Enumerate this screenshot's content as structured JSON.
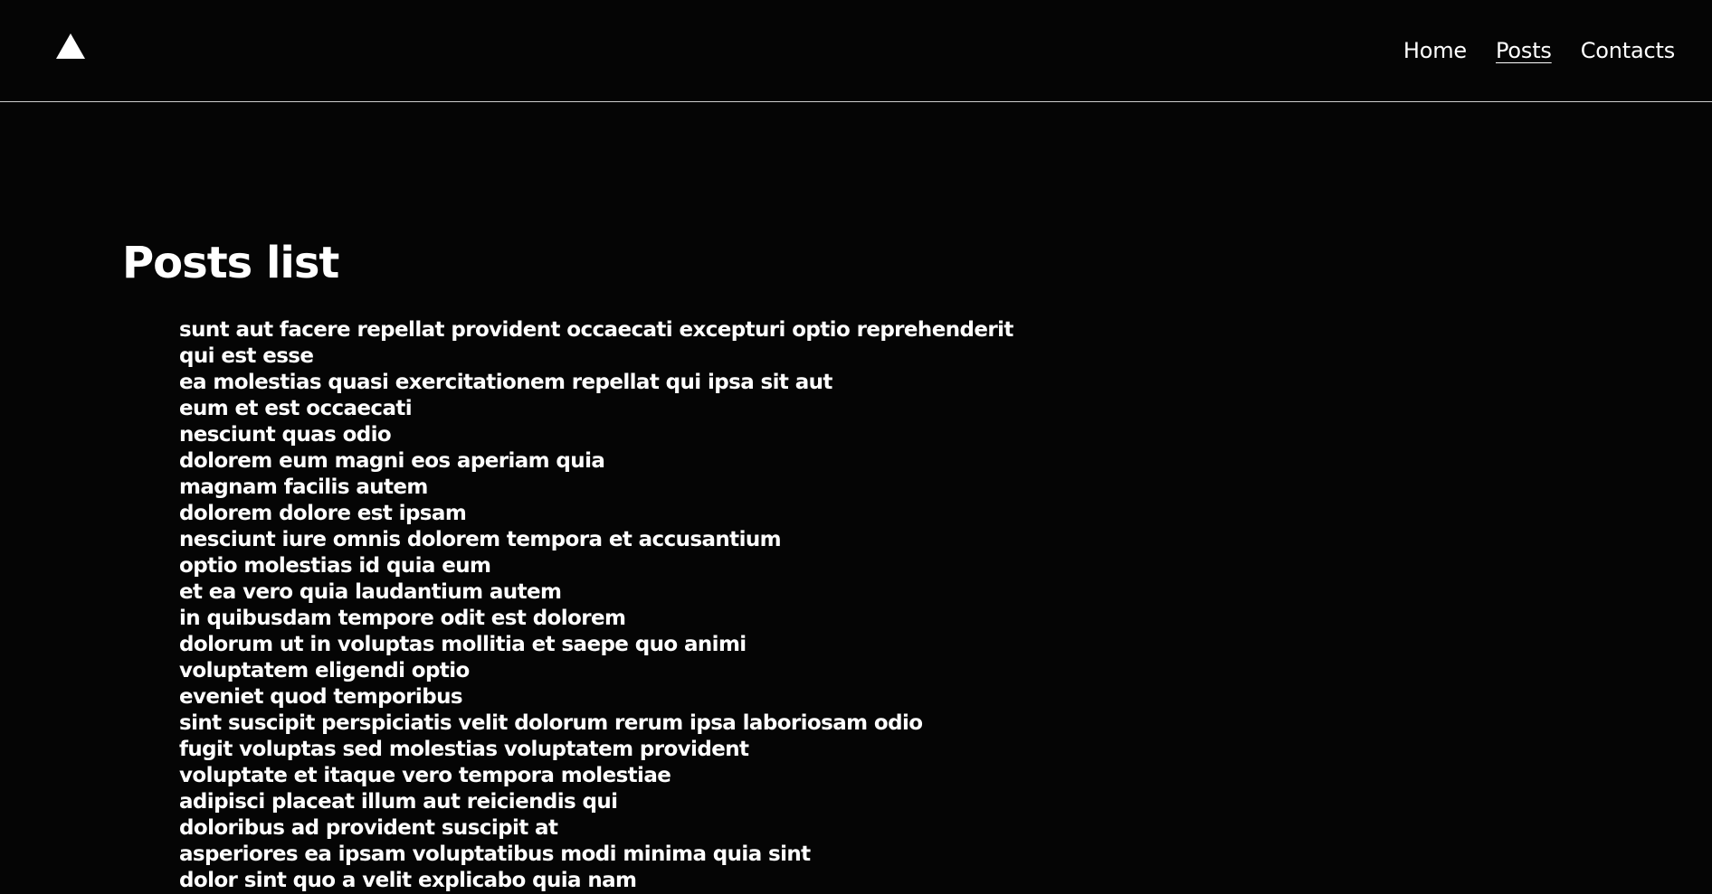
{
  "header": {
    "logo_icon": "triangle-logo-icon",
    "nav": [
      {
        "label": "Home",
        "active": false
      },
      {
        "label": "Posts",
        "active": true
      },
      {
        "label": "Contacts",
        "active": false
      }
    ]
  },
  "main": {
    "title": "Posts list",
    "posts": [
      "sunt aut facere repellat provident occaecati excepturi optio reprehenderit",
      "qui est esse",
      "ea molestias quasi exercitationem repellat qui ipsa sit aut",
      "eum et est occaecati",
      "nesciunt quas odio",
      "dolorem eum magni eos aperiam quia",
      "magnam facilis autem",
      "dolorem dolore est ipsam",
      "nesciunt iure omnis dolorem tempora et accusantium",
      "optio molestias id quia eum",
      "et ea vero quia laudantium autem",
      "in quibusdam tempore odit est dolorem",
      "dolorum ut in voluptas mollitia et saepe quo animi",
      "voluptatem eligendi optio",
      "eveniet quod temporibus",
      "sint suscipit perspiciatis velit dolorum rerum ipsa laboriosam odio",
      "fugit voluptas sed molestias voluptatem provident",
      "voluptate et itaque vero tempora molestiae",
      "adipisci placeat illum aut reiciendis qui",
      "doloribus ad provident suscipit at",
      "asperiores ea ipsam voluptatibus modi minima quia sint",
      "dolor sint quo a velit explicabo quia nam"
    ]
  }
}
